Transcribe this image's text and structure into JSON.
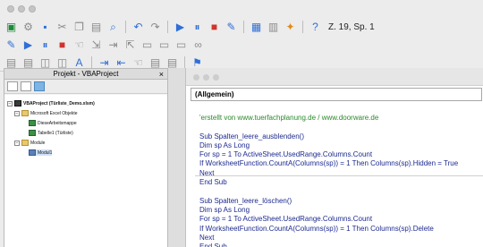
{
  "toolbar": {
    "position_label": "Z. 19, Sp. 1"
  },
  "project_panel": {
    "title": "Projekt - VBAProject",
    "close_label": "×",
    "tree": {
      "project": "VBAProject (Türliste_Demo.xlsm)",
      "excel_objects_folder": "Microsoft Excel Objekte",
      "workbook": "DieseArbeitsmappe",
      "sheet": "Tabelle1 (Türliste)",
      "modules_folder": "Module",
      "module": "Modul1"
    }
  },
  "code_window": {
    "object_combo": "(Allgemein)",
    "lines": [
      "'erstellt von www.tuerfachplanung.de / www.doorware.de",
      "",
      "Sub Spalten_leere_ausblenden()",
      "Dim sp As Long",
      "For sp = 1 To ActiveSheet.UsedRange.Columns.Count",
      "If WorksheetFunction.CountA(Columns(sp)) = 1 Then Columns(sp).Hidden = True",
      "Next",
      "End Sub",
      "",
      "Sub Spalten_leere_löschen()",
      "Dim sp As Long",
      "For sp = 1 To ActiveSheet.UsedRange.Columns.Count",
      "If WorksheetFunction.CountA(Columns(sp)) = 1 Then Columns(sp).Delete",
      "Next",
      "End Sub"
    ]
  }
}
